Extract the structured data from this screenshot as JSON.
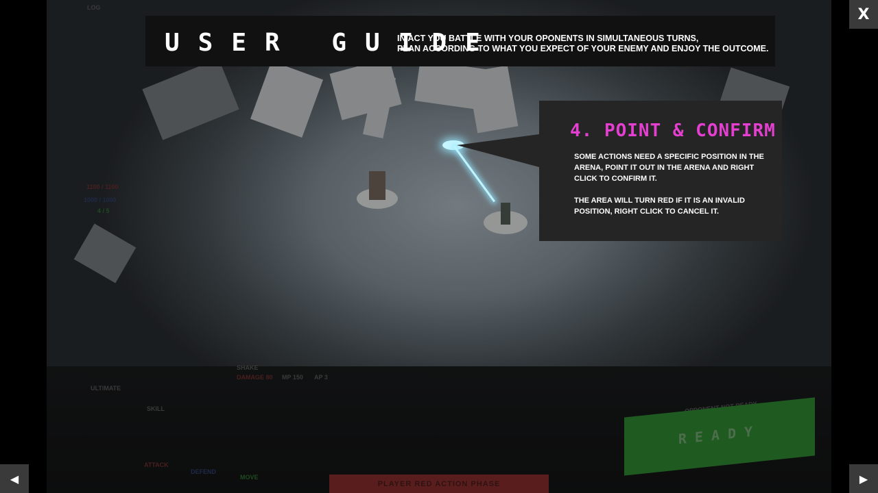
{
  "guide": {
    "title": "USER GUIDE",
    "intro_line1": "IN ACT YOU BATTLE WITH YOUR OPONENTS IN SIMULTANEOUS TURNS,",
    "intro_line2": "PLAN ACCORDING TO WHAT YOU EXPECT OF YOUR ENEMY AND ENJOY THE OUTCOME."
  },
  "step": {
    "title": "4. POINT & CONFIRM",
    "paragraph1": "SOME ACTIONS NEED A SPECIFIC POSITION IN THE ARENA, POINT IT OUT IN THE ARENA AND RIGHT CLICK TO CONFIRM IT.",
    "paragraph2": "THE AREA WILL TURN RED IF IT IS AN INVALID POSITION, RIGHT CLICK TO CANCEL IT."
  },
  "nav": {
    "close_label": "X",
    "prev_label": "◀",
    "next_label": "▶"
  },
  "hud": {
    "log_label": "LOG",
    "hp_text": "1100 / 1100",
    "mp_text": "1000 / 1000",
    "ap_text": "4 / 5",
    "skill_name": "SHAKE",
    "skill_damage": "DAMAGE 80",
    "skill_mp": "MP 150",
    "skill_ap": "AP 3",
    "ultimate_label": "ULTIMATE",
    "skill_label": "SKILL",
    "attack_label": "ATTACK",
    "defend_label": "DEFEND",
    "move_label": "MOVE",
    "opponent_status": "OPPONENT NOT READY",
    "ready_label": "READY",
    "phase_label": "PLAYER RED ACTION PHASE"
  },
  "colors": {
    "accent": "#e43fd0",
    "panel_bg": "#252525",
    "header_bg": "#111111"
  }
}
